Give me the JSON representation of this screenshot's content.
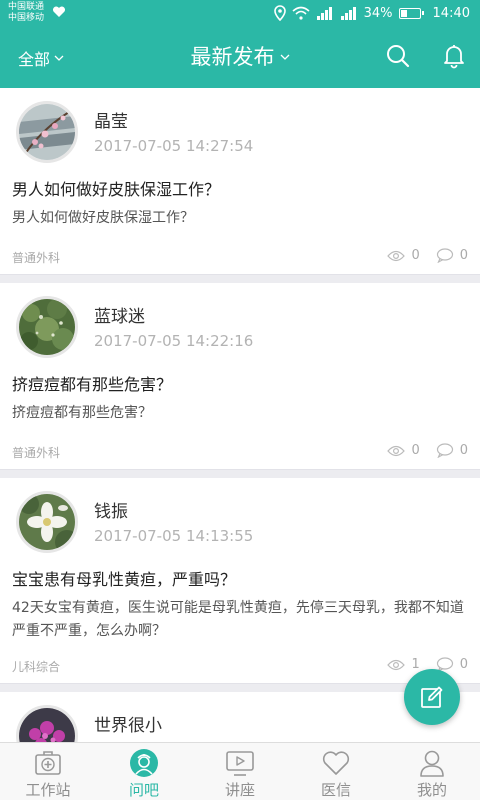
{
  "status_bar": {
    "carrier_1": "中国联通",
    "carrier_2": "中国移动",
    "battery": "34%",
    "battery_level": 0.34,
    "time": "14:40"
  },
  "header": {
    "filter_label": "全部",
    "title": "最新发布",
    "accent_color": "#2bb8a6"
  },
  "posts": [
    {
      "author": "晶莹",
      "time": "2017-07-05 14:27:54",
      "title": "男人如何做好皮肤保湿工作？",
      "body": "男人如何做好皮肤保湿工作？",
      "category": "普通外科",
      "views": "0",
      "comments": "0"
    },
    {
      "author": "蓝球迷",
      "time": "2017-07-05 14:22:16",
      "title": "挤痘痘都有那些危害？",
      "body": "挤痘痘都有那些危害？",
      "category": "普通外科",
      "views": "0",
      "comments": "0"
    },
    {
      "author": "钱振",
      "time": "2017-07-05 14:13:55",
      "title": "宝宝患有母乳性黄疸，严重吗？",
      "body": "42天女宝有黄疸，医生说可能是母乳性黄疸，先停三天母乳，我都不知道严重不严重，怎么办啊？",
      "category": "儿科综合",
      "views": "1",
      "comments": "0"
    },
    {
      "author": "世界很小",
      "time": "",
      "title": "",
      "body": "",
      "category": "",
      "views": "",
      "comments": ""
    }
  ],
  "tabs": [
    {
      "label": "工作站",
      "icon": "medical-kit-icon"
    },
    {
      "label": "问吧",
      "icon": "doctor-icon",
      "active": true
    },
    {
      "label": "讲座",
      "icon": "video-icon"
    },
    {
      "label": "医信",
      "icon": "heart-icon"
    },
    {
      "label": "我的",
      "icon": "person-icon"
    }
  ]
}
